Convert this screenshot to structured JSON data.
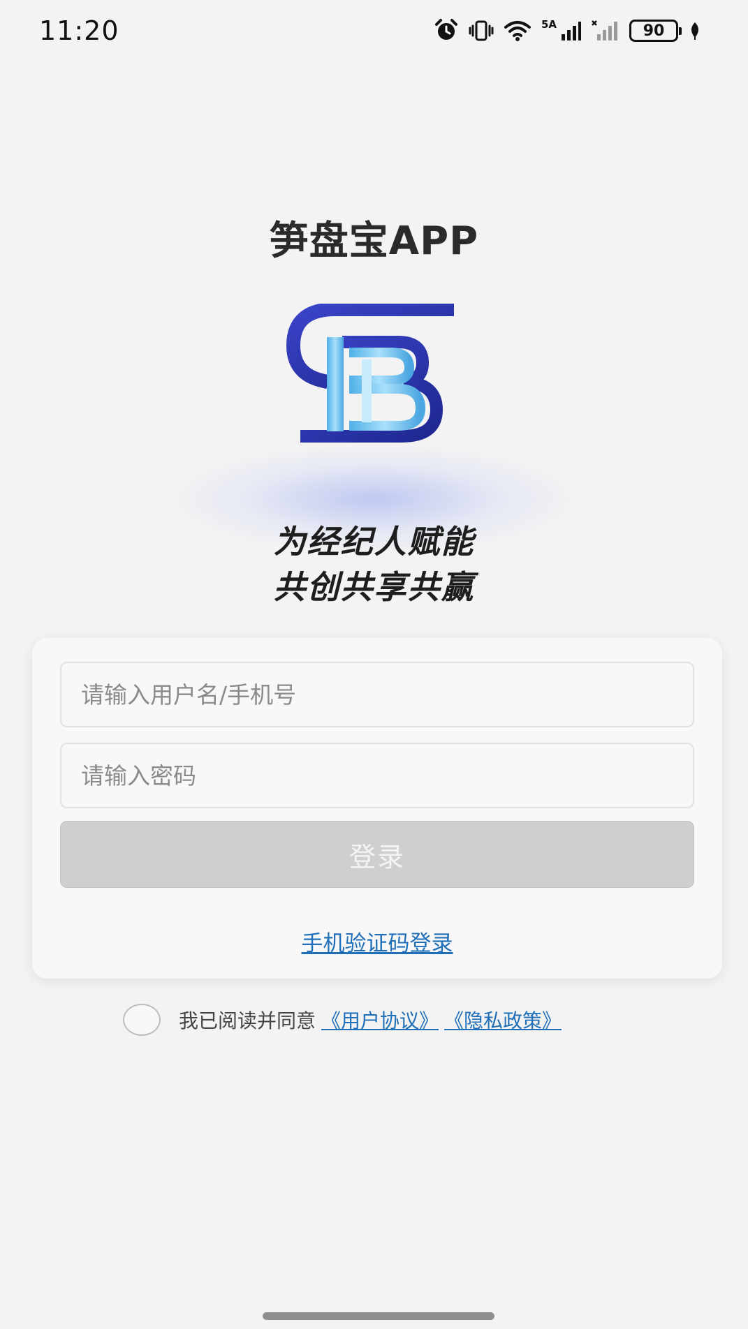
{
  "status_bar": {
    "time": "11:20",
    "network_label": "5A",
    "battery": "90",
    "icons": [
      "alarm-icon",
      "vibrate-icon",
      "wifi-icon",
      "signal-icon",
      "signal-no-service-icon",
      "battery-icon",
      "leaf-icon"
    ]
  },
  "header": {
    "app_title": "笋盘宝APP",
    "logo": "SB-logo",
    "slogan_line1": "为经纪人赋能",
    "slogan_line2": "共创共享共赢"
  },
  "login_form": {
    "username_placeholder": "请输入用户名/手机号",
    "username_value": "",
    "password_placeholder": "请输入密码",
    "password_value": "",
    "login_button": "登录",
    "sms_login_link": "手机验证码登录"
  },
  "agreement": {
    "checked": false,
    "text": "我已阅读并同意",
    "user_agreement": "《用户协议》",
    "privacy_policy": "《隐私政策》"
  },
  "colors": {
    "background": "#f3f3f3",
    "link": "#1f6fb8",
    "button_disabled": "#cfcfcf",
    "logo_dark_blue": "#2b35a8",
    "logo_light_blue": "#6ec3ee"
  }
}
